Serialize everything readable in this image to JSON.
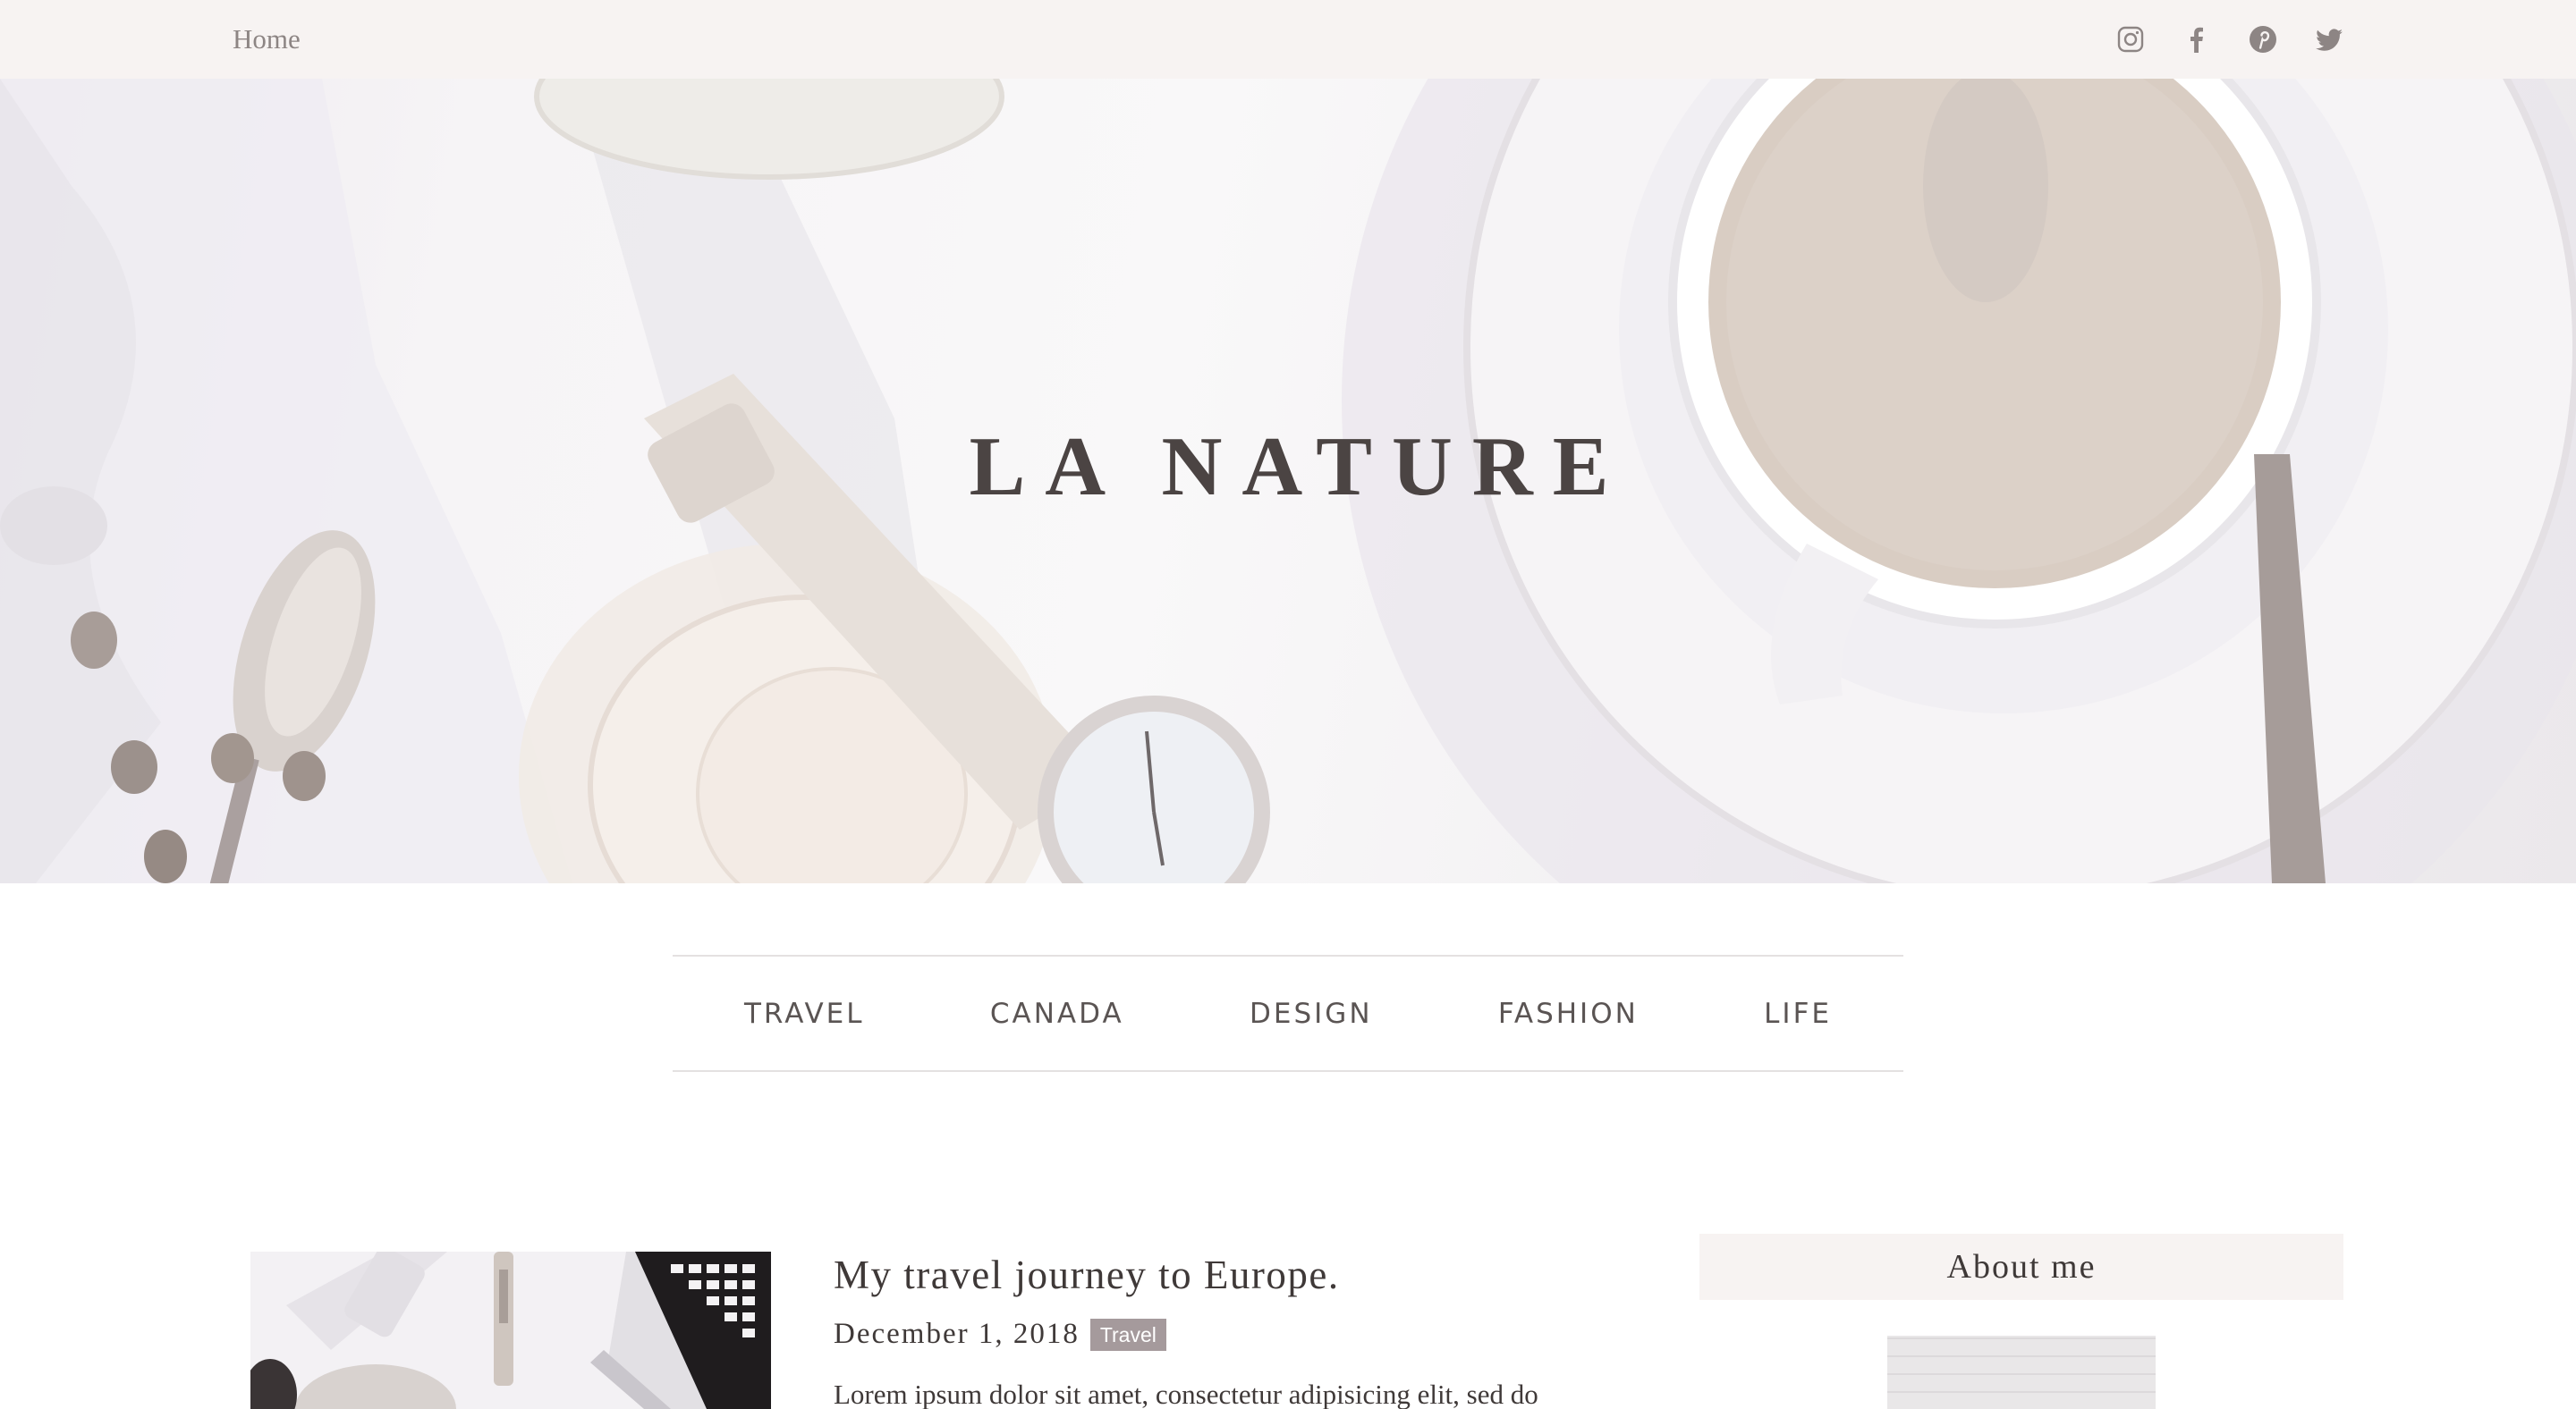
{
  "topbar": {
    "home_label": "Home",
    "social_icons": [
      "instagram-icon",
      "facebook-icon",
      "pinterest-icon",
      "twitter-icon"
    ]
  },
  "hero": {
    "title": "LA NATURE"
  },
  "categories": [
    {
      "label": "TRAVEL"
    },
    {
      "label": "CANADA"
    },
    {
      "label": "DESIGN"
    },
    {
      "label": "FASHION"
    },
    {
      "label": "LIFE"
    }
  ],
  "post": {
    "title": "My travel journey to Europe.",
    "date": "December 1, 2018",
    "tag": "Travel",
    "excerpt": "Lorem ipsum dolor sit amet, consectetur adipisicing elit, sed do"
  },
  "sidebar": {
    "about_heading": "About me"
  },
  "colors": {
    "topbar_bg": "#f7f3f2",
    "text": "#4a4443",
    "muted": "#8d8584",
    "tag_bg": "#a59a9c"
  }
}
